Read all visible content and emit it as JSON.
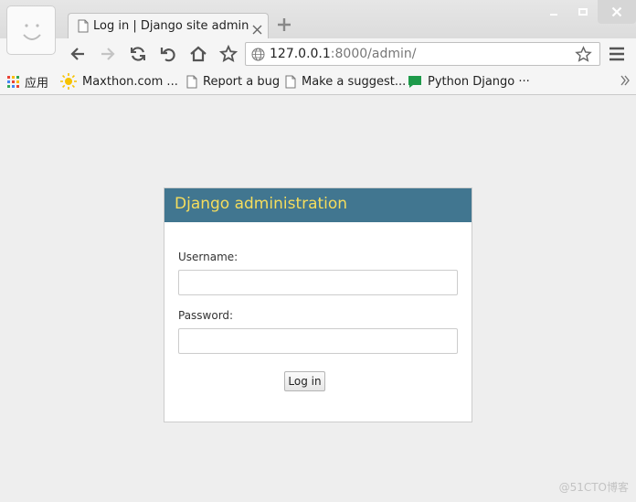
{
  "browser": {
    "tab": {
      "title": "Log in | Django site admin"
    },
    "address_bar": {
      "host": "127.0.0.1",
      "path": ":8000/admin/"
    },
    "bookmarks": [
      {
        "label": "应用",
        "icon": "apps-grid-icon"
      },
      {
        "label": "Maxthon.com ...",
        "icon": "sun-icon"
      },
      {
        "label": "Report a bug",
        "icon": "page-icon"
      },
      {
        "label": "Make a suggest...",
        "icon": "page-icon"
      },
      {
        "label": "Python Django ···",
        "icon": "green-bookmark-icon"
      }
    ]
  },
  "login": {
    "heading": "Django administration",
    "username_label": "Username:",
    "username_value": "",
    "password_label": "Password:",
    "password_value": "",
    "submit_label": "Log in"
  },
  "watermark": "@51CTO博客",
  "colors": {
    "header_bg": "#417690",
    "header_text": "#f5dd5d",
    "page_bg": "#eeeeee"
  }
}
